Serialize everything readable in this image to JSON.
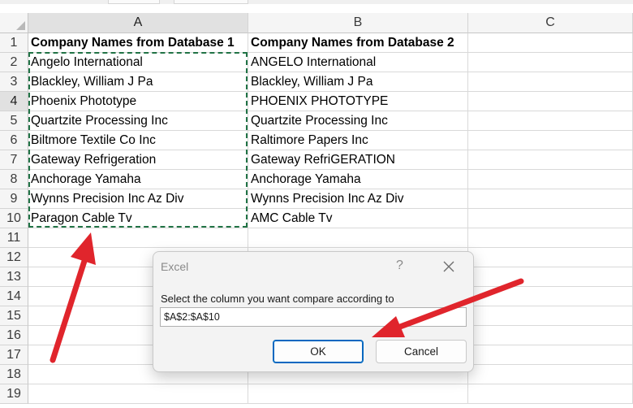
{
  "columns": [
    {
      "label": "A"
    },
    {
      "label": "B"
    },
    {
      "label": "C"
    }
  ],
  "rows": [
    "1",
    "2",
    "3",
    "4",
    "5",
    "6",
    "7",
    "8",
    "9",
    "10",
    "11",
    "12",
    "13",
    "14",
    "15",
    "16",
    "17",
    "18",
    "19"
  ],
  "selected_row": "4",
  "selected_column": "A",
  "cells": {
    "headers": [
      "Company Names from Database 1",
      "Company Names from Database 2"
    ],
    "col_a": [
      "Angelo International",
      "Blackley, William J Pa",
      "Phoenix Phototype",
      "Quartzite Processing Inc",
      "Biltmore Textile Co Inc",
      "Gateway Refrigeration",
      "Anchorage Yamaha",
      "Wynns Precision Inc Az Div",
      "Paragon Cable Tv"
    ],
    "col_b": [
      "ANGELO International",
      "Blackley, William J Pa",
      "PHOENIX PHOTOTYPE",
      "Quartzite Processing Inc",
      "Raltimore Papers Inc",
      "Gateway RefriGERATION",
      "Anchorage Yamaha",
      "Wynns Precision Inc Az Div",
      "AMC Cable Tv"
    ]
  },
  "dialog": {
    "title": "Excel",
    "help_label": "?",
    "prompt": "Select the column you want compare according to",
    "input_value": "$A$2:$A$10",
    "ok_label": "OK",
    "cancel_label": "Cancel"
  },
  "colors": {
    "selection_marquee": "#217346",
    "annotation_arrow": "#e0252c",
    "ok_button_border": "#0067c0"
  },
  "icons": [
    "close-icon",
    "select-all-icon",
    "annotation-arrow"
  ]
}
